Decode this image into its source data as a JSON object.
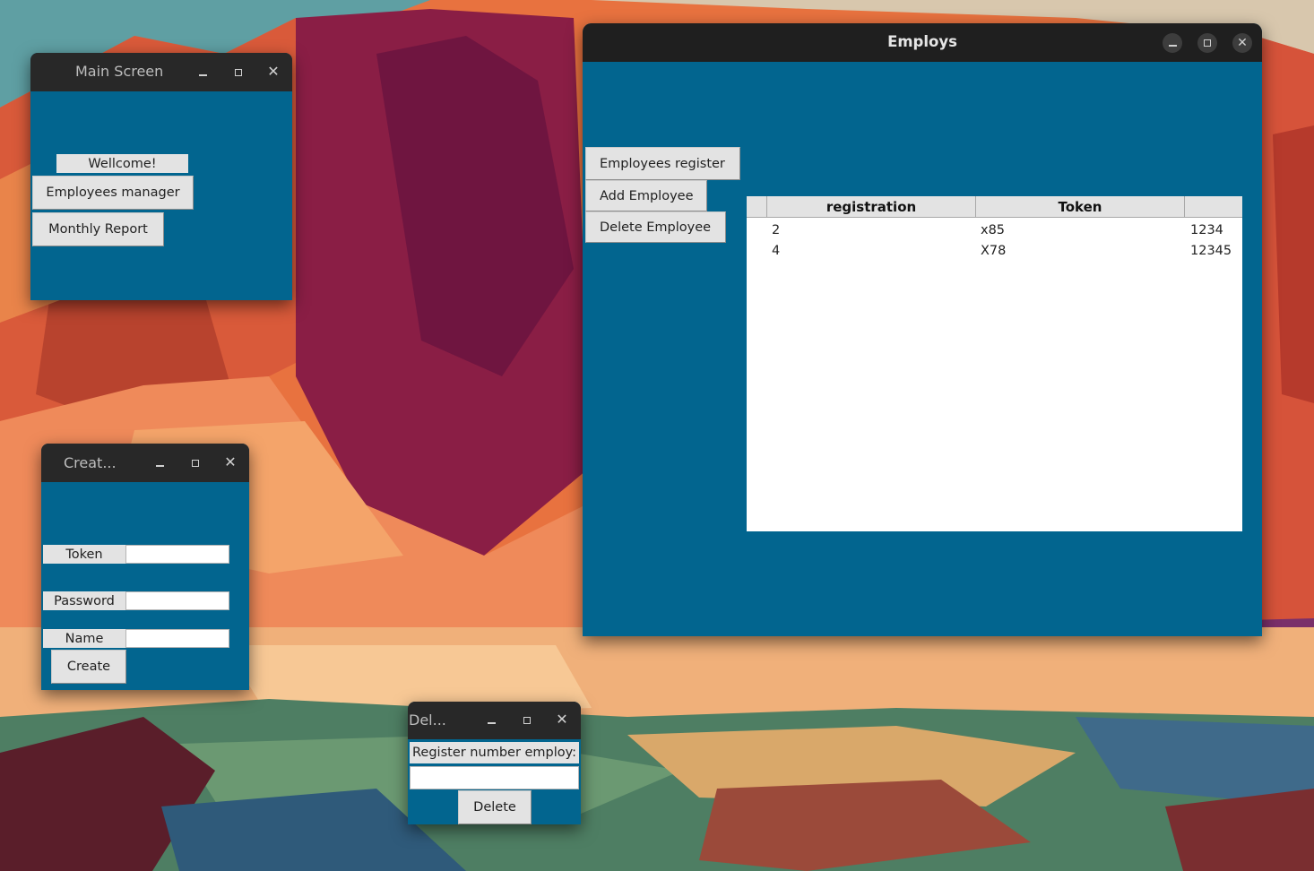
{
  "main_window": {
    "title": "Main Screen",
    "welcome_label": "Wellcome!",
    "employees_manager_button": "Employees manager",
    "monthly_report_button": "Monthly Report"
  },
  "employs_window": {
    "title": "Employs",
    "employees_register_button": "Employees register",
    "add_employee_button": "Add Employee",
    "delete_employee_button": "Delete Employee",
    "table": {
      "columns": [
        "registration",
        "Token"
      ],
      "rows": [
        {
          "id": "2",
          "registration": "x85",
          "token": "1234"
        },
        {
          "id": "4",
          "registration": "X78",
          "token": "12345"
        }
      ]
    }
  },
  "create_window": {
    "title": "Creat...",
    "token_label": "Token",
    "password_label": "Password",
    "name_label": "Name",
    "create_button": "Create"
  },
  "delete_window": {
    "title": "Del...",
    "register_label": "Register number employ:",
    "delete_button": "Delete"
  },
  "colors": {
    "window_bg": "#02658f",
    "titlebar": "#282828",
    "button_bg": "#e3e3e3"
  }
}
